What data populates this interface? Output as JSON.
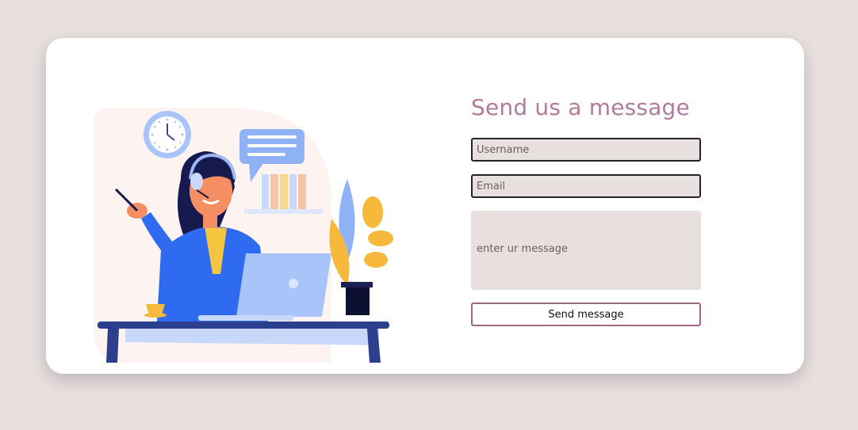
{
  "form": {
    "title": "Send us a message",
    "username_placeholder": "Username",
    "email_placeholder": "Email",
    "message_placeholder": "enter ur message",
    "submit_label": "Send message"
  },
  "colors": {
    "page_background": "#e8dfdf",
    "card_background": "#ffffff",
    "title": "#b27b9c",
    "field_background": "#e8dfdf",
    "field_border": "#23232a",
    "button_border": "#9a6a86"
  },
  "icons": {
    "clock": "clock-icon",
    "chat_bubble": "chat-bubble-icon"
  }
}
